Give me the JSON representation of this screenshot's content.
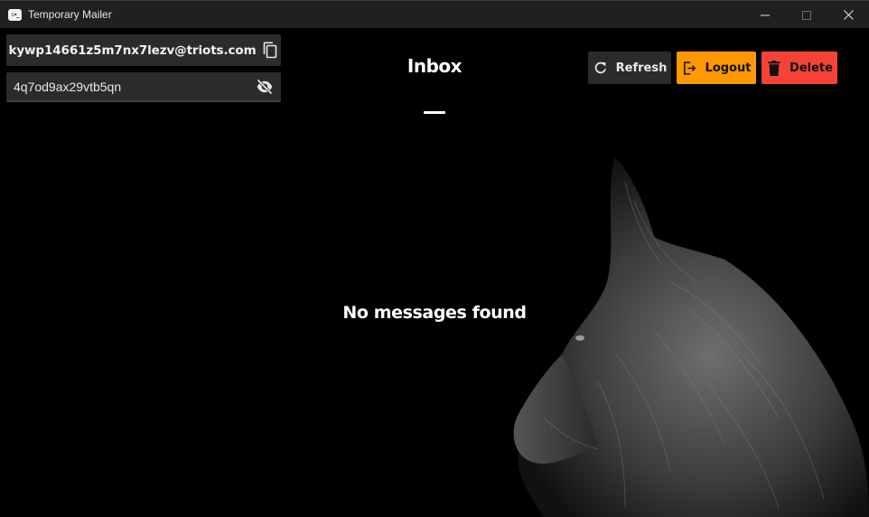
{
  "window": {
    "title": "Temporary Mailer",
    "icon_text": ":>_"
  },
  "account": {
    "email": "kywp14661z5m7nx7lezv@triots.com",
    "password": "4q7od9ax29vtb5qn"
  },
  "inbox": {
    "title": "Inbox",
    "empty_message": "No messages found"
  },
  "toolbar": {
    "refresh_label": "Refresh",
    "logout_label": "Logout",
    "delete_label": "Delete"
  },
  "icons": {
    "copy": "copy-icon",
    "visibility_off": "eye-off-icon",
    "refresh": "refresh-icon",
    "logout": "logout-icon",
    "delete": "trash-icon"
  },
  "colors": {
    "titlebar": "#202020",
    "background": "#000000",
    "field": "#2b2b2b",
    "logout": "#ff9800",
    "delete": "#f44336"
  }
}
